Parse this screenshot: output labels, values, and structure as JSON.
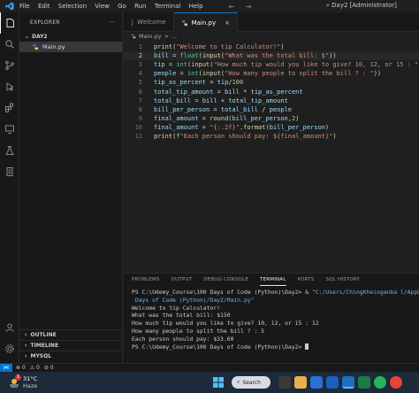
{
  "titlebar": {
    "menu": [
      "File",
      "Edit",
      "Selection",
      "View",
      "Go",
      "Run",
      "Terminal",
      "Help"
    ],
    "back_glyph": "←",
    "forward_glyph": "→",
    "search_text": "Day2 [Administrator]",
    "search_glyph": "⌕"
  },
  "activity_icons": [
    "explorer-icon",
    "search-icon",
    "source-control-icon",
    "run-debug-icon",
    "extensions-icon",
    "remote-explorer-icon",
    "testing-icon",
    "docker-icon"
  ],
  "sidebar": {
    "header": "EXPLORER",
    "header_menu": "···",
    "folder": "DAY2",
    "file": "Main.py",
    "sections": [
      "OUTLINE",
      "TIMELINE",
      "MYSQL"
    ],
    "chevron": "›",
    "folder_chevron": "⌄"
  },
  "tabs": [
    {
      "label": "Welcome",
      "active": false
    },
    {
      "label": "Main.py",
      "active": true,
      "close": "×"
    }
  ],
  "breadcrumb": {
    "file": "Main.py",
    "sep": ">",
    "tail": "..."
  },
  "editor": {
    "current_line": 2,
    "lines": [
      "print(\"Welcome to tip Calculator!\")",
      "bill = float(input(\"What was the total bill: $\"))",
      "tip = int(input(\"How much tip would you like to give? 10, 12, or 15 : \"))",
      "people = int(input(\"How many people to split the bill ? : \"))",
      "tip_as_percent = tip/100",
      "total_tip_amount = bill * tip_as_percent",
      "total_bill = bill + total_tip_amount",
      "bill_per_person = total_bill / people",
      "final_amount = round(bill_per_person,2)",
      "final_amount = \"{:.2f}\".format(bill_per_person)",
      "print(f\"Each person should pay: ${final_amount}\")"
    ]
  },
  "panel": {
    "tabs": [
      "PROBLEMS",
      "OUTPUT",
      "DEBUG CONSOLE",
      "TERMINAL",
      "PORTS",
      "SQL HISTORY"
    ],
    "active_tab": "TERMINAL",
    "terminal": [
      "PS C:\\Udemy_Course\\100 Days of Code (Python)\\Day2> & \"C:/Users/ChingKheinganba l/AppDa",
      " Days of Code (Python)/Day2/Main.py\"",
      "Welcome to tip Calculator!",
      "What was the total bill: $150",
      "How much tip would you like to give? 10, 12, or 15 : 12",
      "How many people to split the bill ? : 5",
      "Each person should pay: $33.60",
      "PS C:\\Udemy_Course\\100 Days of Code (Python)\\Day2> "
    ]
  },
  "statusbar": {
    "remote_glyph": "⋈",
    "errors": "⊗ 0",
    "warnings": "⚠ 0",
    "info": "⊘ 0"
  },
  "taskbar": {
    "weather_temp": "31°C",
    "weather_desc": "Haze",
    "weather_badge": "1",
    "search_label": "Search",
    "search_glyph": "⌕"
  },
  "colors": {
    "accent": "#0078d4",
    "keyword_fn": "#dcdcaa",
    "variable": "#9cdcfe",
    "string": "#ce9178",
    "number": "#b5cea8",
    "builtin": "#4ec9b0"
  }
}
